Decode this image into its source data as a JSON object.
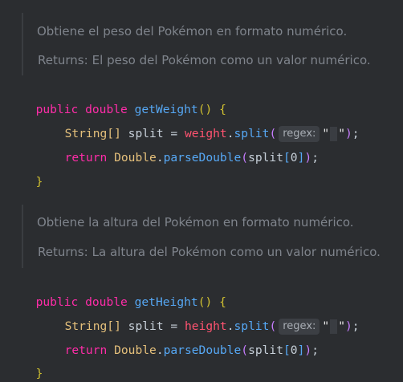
{
  "editor": {
    "blocks": [
      {
        "doc_summary": "Obtiene el peso del Pokémon en formato numérico.",
        "doc_returns_tag": "Returns:",
        "doc_returns_text": "El peso del Pokémon como un valor numérico.",
        "modifiers": "public",
        "return_type": "double",
        "method_name": "getWeight",
        "open_sig": "() {",
        "line1_type": "String[]",
        "line1_var": "split",
        "line1_eq": "=",
        "line1_field": "weight",
        "line1_call": "split",
        "line1_hint": "regex:",
        "line1_str_open": "\"",
        "line1_str_close": "\"",
        "line1_end": ");",
        "line2_kw": "return",
        "line2_cls": "Double",
        "line2_call": "parseDouble",
        "line2_arg": "split",
        "line2_index": "0",
        "line2_end": ");",
        "close": "}"
      },
      {
        "doc_summary": "Obtiene la altura del Pokémon en formato numérico.",
        "doc_returns_tag": "Returns:",
        "doc_returns_text": "La altura del Pokémon como un valor numérico.",
        "modifiers": "public",
        "return_type": "double",
        "method_name": "getHeight",
        "open_sig": "() {",
        "line1_type": "String[]",
        "line1_var": "split",
        "line1_eq": "=",
        "line1_field": "height",
        "line1_call": "split",
        "line1_hint": "regex:",
        "line1_str_open": "\"",
        "line1_str_close": "\"",
        "line1_end": ");",
        "line2_kw": "return",
        "line2_cls": "Double",
        "line2_call": "parseDouble",
        "line2_arg": "split",
        "line2_index": "0",
        "line2_end": ");",
        "close": "}"
      }
    ]
  }
}
